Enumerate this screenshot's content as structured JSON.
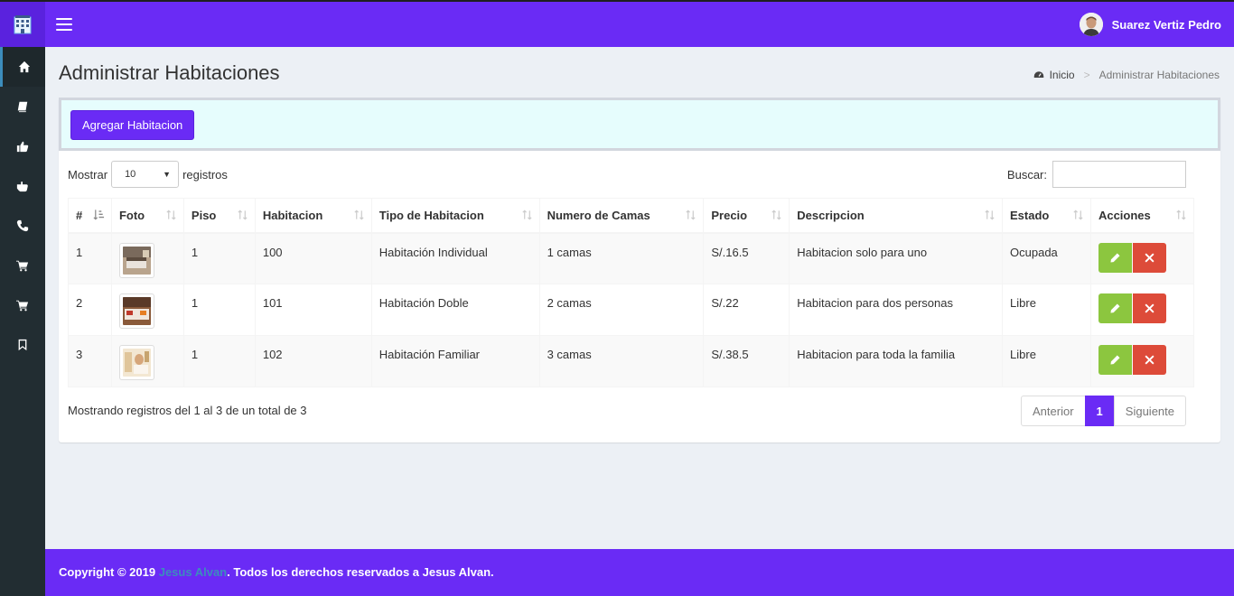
{
  "header": {
    "user_name": "Suarez Vertiz Pedro"
  },
  "sidebar": {
    "items": [
      {
        "icon": "home-icon",
        "active": true
      },
      {
        "icon": "book-icon",
        "active": false
      },
      {
        "icon": "thumbs-up-icon",
        "active": false
      },
      {
        "icon": "hand-pointer-icon",
        "active": false
      },
      {
        "icon": "phone-icon",
        "active": false
      },
      {
        "icon": "cart-icon",
        "active": false
      },
      {
        "icon": "cart-icon",
        "active": false
      },
      {
        "icon": "bookmark-icon",
        "active": false
      }
    ]
  },
  "page": {
    "title": "Administrar Habitaciones",
    "breadcrumb": {
      "home": "Inicio",
      "current": "Administrar Habitaciones"
    }
  },
  "actions": {
    "add_label": "Agregar Habitacion"
  },
  "table_controls": {
    "show_label": "Mostrar",
    "length_value": "10",
    "records_label": "registros",
    "search_label": "Buscar:",
    "search_value": ""
  },
  "table": {
    "columns": [
      "#",
      "Foto",
      "Piso",
      "Habitacion",
      "Tipo de Habitacion",
      "Numero de Camas",
      "Precio",
      "Descripcion",
      "Estado",
      "Acciones"
    ],
    "rows": [
      {
        "num": "1",
        "photo": "room-photo-individual",
        "floor": "1",
        "room": "100",
        "type": "Habitación Individual",
        "beds": "1 camas",
        "price": "S/.16.5",
        "description": "Habitacion solo para uno",
        "status": "Ocupada"
      },
      {
        "num": "2",
        "photo": "room-photo-doble",
        "floor": "1",
        "room": "101",
        "type": "Habitación Doble",
        "beds": "2 camas",
        "price": "S/.22",
        "description": "Habitacion para dos personas",
        "status": "Libre"
      },
      {
        "num": "3",
        "photo": "room-photo-familiar",
        "floor": "1",
        "room": "102",
        "type": "Habitación Familiar",
        "beds": "3 camas",
        "price": "S/.38.5",
        "description": "Habitacion para toda la familia",
        "status": "Libre"
      }
    ]
  },
  "pagination": {
    "info": "Mostrando registros del 1 al 3 de un total de 3",
    "prev": "Anterior",
    "current": "1",
    "next": "Siguiente"
  },
  "footer": {
    "prefix": "Copyright © 2019 ",
    "author_link": "Jesus Alvan",
    "suffix": ". Todos los derechos reservados a Jesus Alvan."
  },
  "colors": {
    "brand": "#6a2bf5",
    "sidebar": "#222d32",
    "edit": "#8cc63f",
    "delete": "#dd4b39",
    "header_box": "#e6fdfd"
  }
}
